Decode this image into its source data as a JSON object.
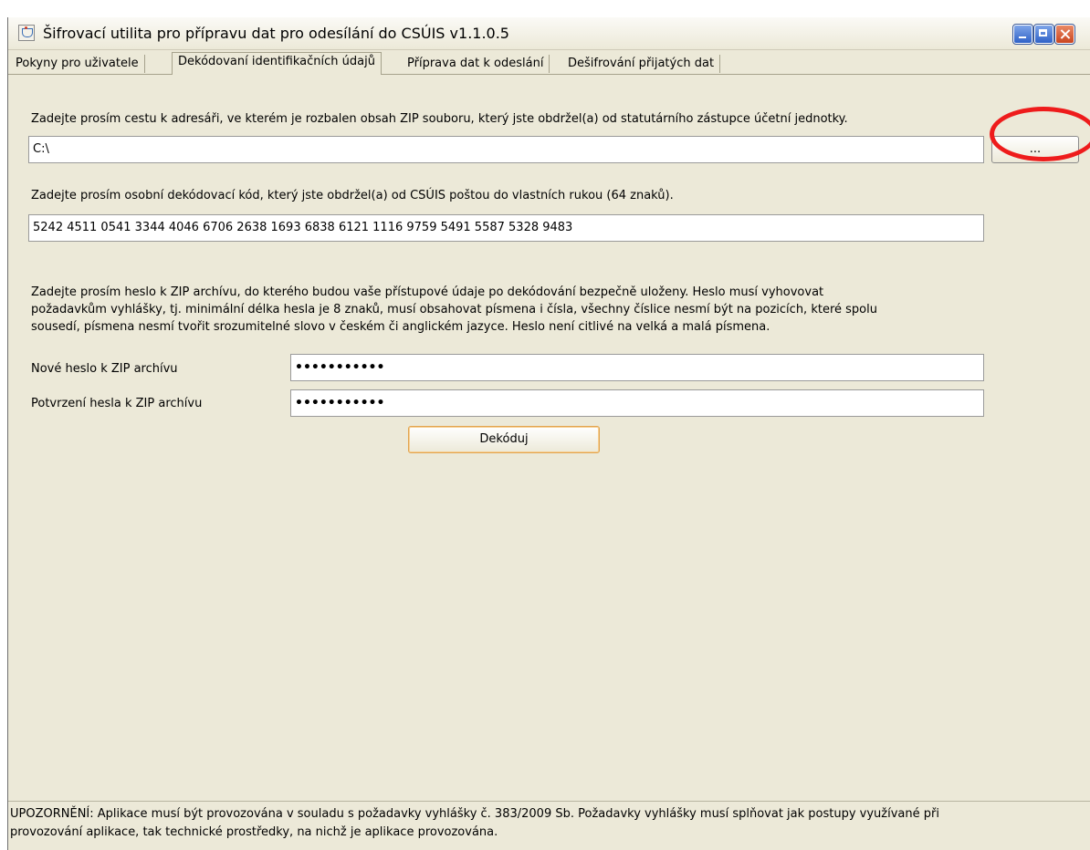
{
  "window": {
    "title": "Šifrovací utilita pro přípravu dat pro odesílání do CSÚIS v1.1.0.5"
  },
  "tabs": [
    {
      "label": "Pokyny pro uživatele",
      "active": false
    },
    {
      "label": "Dekódovaní identifikačních údajů",
      "active": true
    },
    {
      "label": "Příprava dat k odeslání",
      "active": false
    },
    {
      "label": "Dešifrování přijatých dat",
      "active": false
    }
  ],
  "form": {
    "path_instruction": "Zadejte prosím cestu k adresáři, ve kterém je rozbalen obsah ZIP souboru, který jste obdržel(a) od statutárního zástupce účetní jednotky.",
    "path_value": "C:\\",
    "browse_label": "...",
    "code_instruction": "Zadejte prosím osobní dekódovací kód, který jste obdržel(a) od CSÚIS poštou do vlastních rukou (64 znaků).",
    "code_value": "5242 4511 0541 3344 4046 6706 2638 1693 6838 6121 1116 9759 5491 5587 5328 9483",
    "password_instruction_lines": [
      "Zadejte prosím heslo k ZIP archívu, do kterého budou vaše přístupové údaje po dekódování bezpečně uloženy. Heslo musí vyhovovat",
      "požadavkům vyhlášky, tj. minimální délka hesla je 8 znaků, musí obsahovat písmena i čísla, všechny číslice nesmí být na pozicích, které spolu",
      "sousedí, písmena nesmí tvořit srozumitelné slovo v českém či anglickém jazyce. Heslo není citlivé na velká a malá písmena."
    ],
    "new_password_label": "Nové heslo k ZIP archívu",
    "new_password_value": "•••••••••••",
    "confirm_password_label": "Potvrzení hesla k ZIP archívu",
    "confirm_password_value": "•••••••••••",
    "decode_button": "Dekóduj"
  },
  "warning_lines": [
    "UPOZORNĚNÍ: Aplikace musí být provozována v souladu s požadavky vyhlášky č. 383/2009 Sb. Požadavky vyhlášky musí splňovat jak postupy využívané při",
    "provozování aplikace, tak technické prostředky, na nichž je aplikace provozována."
  ],
  "colors": {
    "window_bg": "#ece9d8",
    "highlight": "#ee1c1c",
    "decode_border": "#e2a44f"
  }
}
